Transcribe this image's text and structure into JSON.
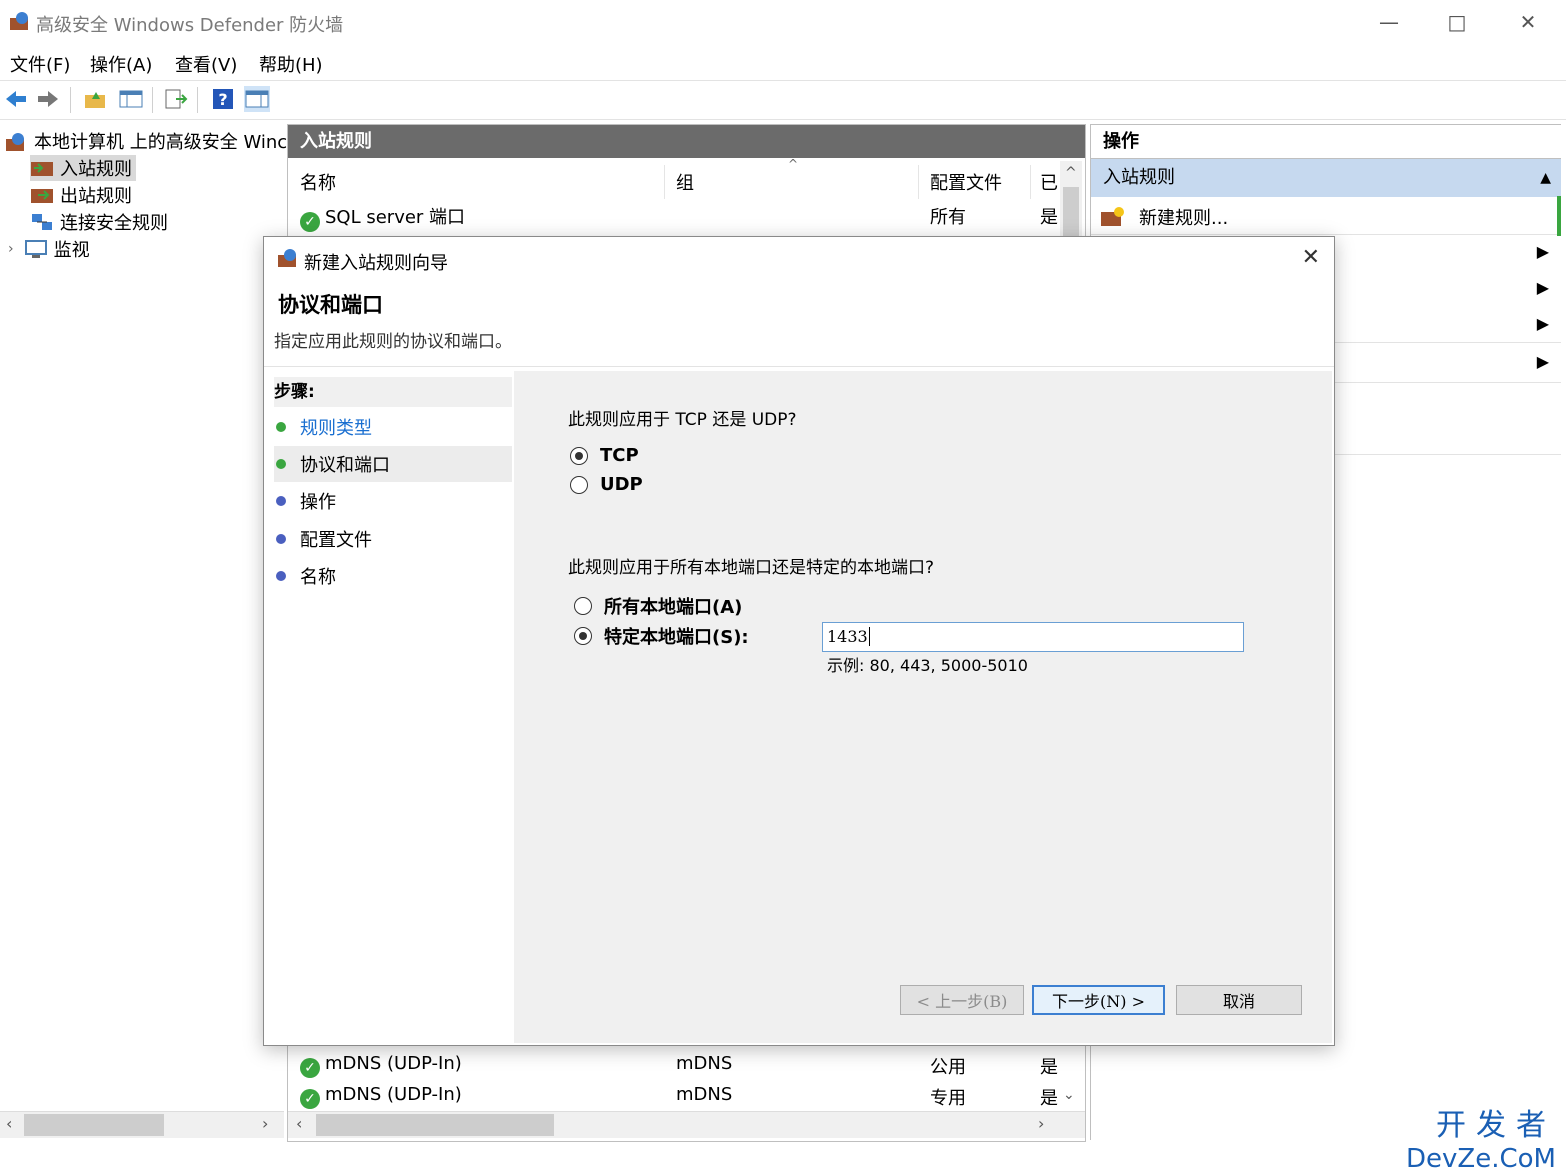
{
  "window": {
    "title": "高级安全 Windows Defender 防火墙"
  },
  "menu": [
    "文件(F)",
    "操作(A)",
    "查看(V)",
    "帮助(H)"
  ],
  "tree": {
    "root": "本地计算机 上的高级安全 Winc",
    "items": [
      "入站规则",
      "出站规则",
      "连接安全规则",
      "监视"
    ]
  },
  "middle": {
    "title": "入站规则",
    "columns": [
      "名称",
      "组",
      "配置文件",
      "已"
    ],
    "rows_top": [
      {
        "name": "SQL server 端口",
        "group": "",
        "profile": "所有",
        "enabled": "是"
      }
    ],
    "rows_bottom": [
      {
        "name": "mDNS (UDP-In)",
        "group": "mDNS",
        "profile": "公用",
        "enabled": "是"
      },
      {
        "name": "mDNS (UDP-In)",
        "group": "mDNS",
        "profile": "专用",
        "enabled": "是"
      }
    ]
  },
  "actions": {
    "title": "操作",
    "section": "入站规则",
    "new_rule": "新建规则..."
  },
  "dialog": {
    "title": "新建入站规则向导",
    "heading": "协议和端口",
    "description": "指定应用此规则的协议和端口。",
    "steps_label": "步骤:",
    "steps": [
      "规则类型",
      "协议和端口",
      "操作",
      "配置文件",
      "名称"
    ],
    "q_protocol": "此规则应用于 TCP 还是 UDP?",
    "protocols": [
      "TCP",
      "UDP"
    ],
    "selected_protocol": "TCP",
    "q_ports": "此规则应用于所有本地端口还是特定的本地端口?",
    "port_all": "所有本地端口(A)",
    "port_specific": "特定本地端口(S):",
    "selected_port_option": "特定本地端口(S):",
    "port_value": "1433",
    "port_example": "示例: 80, 443, 5000-5010",
    "buttons": {
      "back": "< 上一步(B)",
      "next": "下一步(N) >",
      "cancel": "取消"
    }
  },
  "watermark": {
    "cn": "开发者",
    "en": "DevZe.CoM"
  },
  "colors": {
    "accent": "#3c7fd1",
    "header_gray": "#6b6b6b",
    "selection": "#c6d9ef",
    "check_green": "#3aa640",
    "link_blue": "#1a6fd0"
  }
}
